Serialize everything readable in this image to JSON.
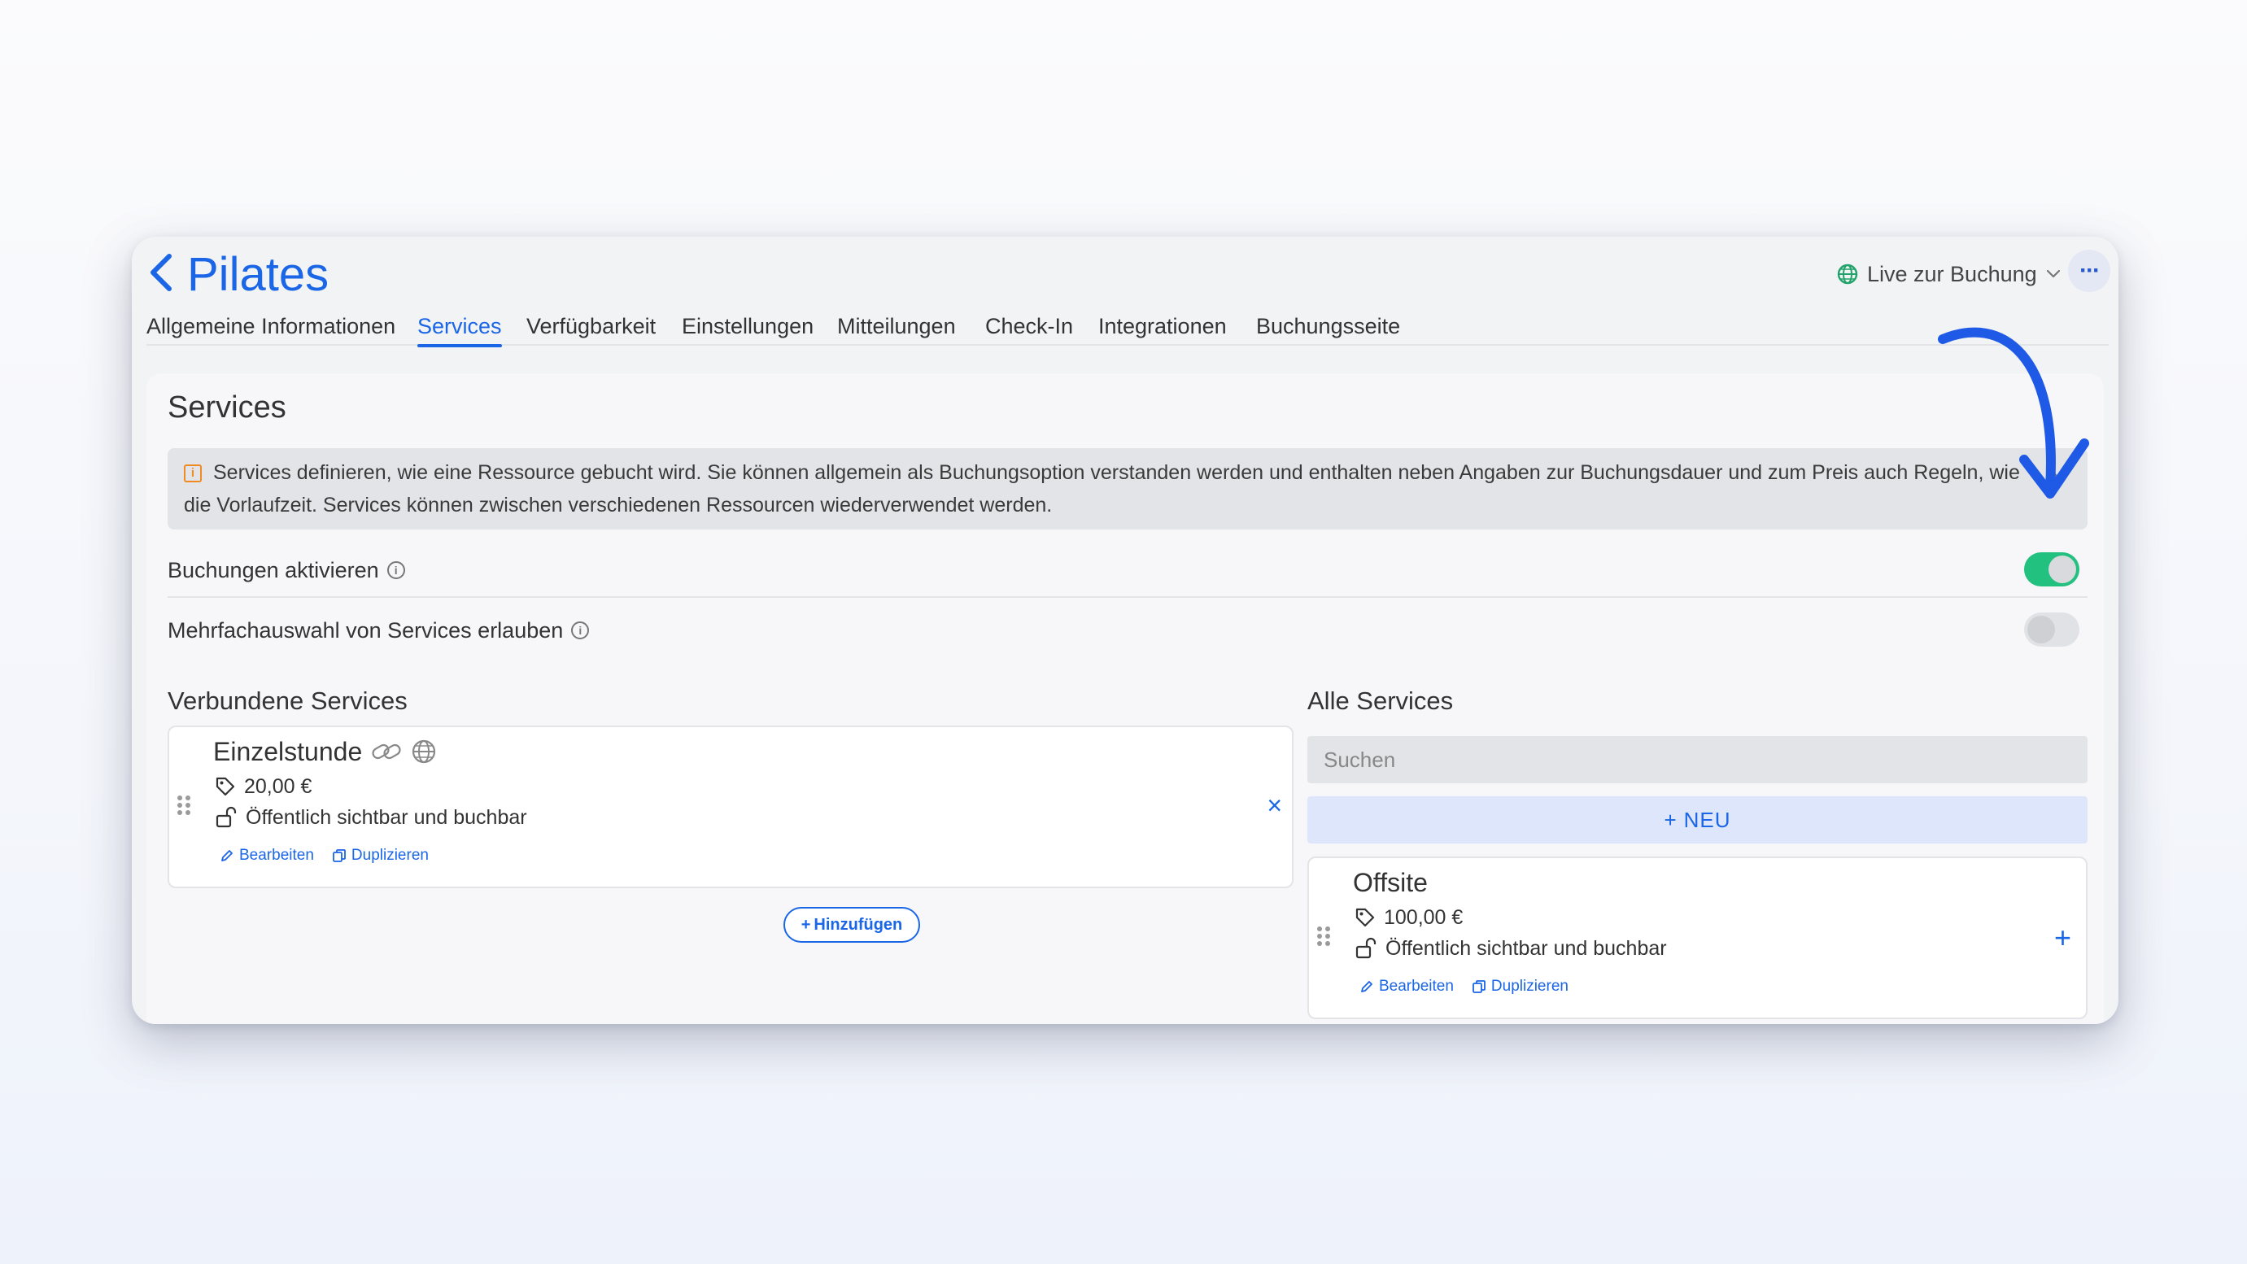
{
  "header": {
    "title": "Pilates",
    "status_label": "Live zur Buchung",
    "more_label": "···"
  },
  "tabs": [
    {
      "label": "Allgemeine Informationen",
      "active": false
    },
    {
      "label": "Services",
      "active": true
    },
    {
      "label": "Verfügbarkeit",
      "active": false
    },
    {
      "label": "Einstellungen",
      "active": false
    },
    {
      "label": "Mitteilungen",
      "active": false
    },
    {
      "label": "Check-In",
      "active": false
    },
    {
      "label": "Integrationen",
      "active": false
    },
    {
      "label": "Buchungsseite",
      "active": false
    }
  ],
  "panel": {
    "title": "Services",
    "info_text": "Services definieren, wie eine Ressource gebucht wird. Sie können allgemein als Buchungsoption verstanden werden und enthalten neben Angaben zur Buchungsdauer und zum Preis auch Regeln, wie die Vorlaufzeit. Services können zwischen verschiedenen Ressourcen wiederverwendet werden.",
    "close_label": "×",
    "settings": [
      {
        "label": "Buchungen aktivieren",
        "enabled": true
      },
      {
        "label": "Mehrfachauswahl von Services erlauben",
        "enabled": false
      }
    ]
  },
  "connected": {
    "title": "Verbundene Services",
    "services": [
      {
        "name": "Einzelstunde",
        "price": "20,00 €",
        "visibility": "Öffentlich sichtbar und buchbar",
        "edit_label": "Bearbeiten",
        "duplicate_label": "Duplizieren",
        "remove_label": "×"
      }
    ],
    "add_label": "Hinzufügen"
  },
  "all_services": {
    "title": "Alle Services",
    "search_placeholder": "Suchen",
    "new_label": "NEU",
    "services": [
      {
        "name": "Offsite",
        "price": "100,00 €",
        "visibility": "Öffentlich sichtbar und buchbar",
        "edit_label": "Bearbeiten",
        "duplicate_label": "Duplizieren",
        "add_label": "+"
      }
    ]
  },
  "colors": {
    "accent": "#1a66e6",
    "toggle_on": "#22c17f",
    "warning": "#f08a24",
    "live_globe": "#22a36b"
  },
  "icons": [
    "chevron-left-icon",
    "globe-icon",
    "chevron-down-icon",
    "more-icon",
    "info-icon",
    "link-icon",
    "tag-icon",
    "unlock-icon",
    "pencil-icon",
    "copy-icon",
    "drag-handle-icon",
    "close-icon",
    "plus-icon",
    "arrow-annotation"
  ]
}
